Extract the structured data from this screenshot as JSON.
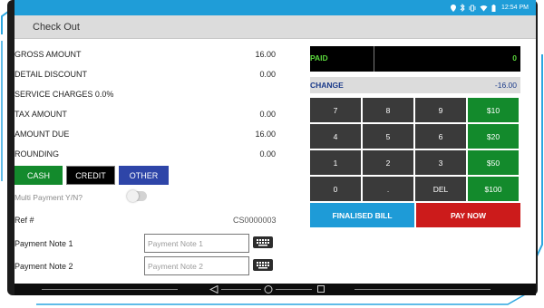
{
  "status_bar": {
    "icons": [
      "location-icon",
      "bluetooth-icon",
      "vibrate-icon",
      "wifi-icon",
      "battery-icon"
    ],
    "time": "12:54 PM",
    "color": "#1f9dd8"
  },
  "header": {
    "title": "Check Out"
  },
  "summary": {
    "gross_amount": {
      "label": "GROSS AMOUNT",
      "value": "16.00"
    },
    "detail_discount": {
      "label": "DETAIL DISCOUNT",
      "value": "0.00"
    },
    "service_charges": {
      "label": "SERVICE CHARGES 0.0%",
      "value": ""
    },
    "tax_amount": {
      "label": "TAX AMOUNT",
      "value": "0.00"
    },
    "amount_due": {
      "label": "AMOUNT DUE",
      "value": "16.00"
    },
    "rounding": {
      "label": "ROUNDING",
      "value": "0.00"
    }
  },
  "payment_types": [
    {
      "label": "CASH",
      "color": "#138a2c"
    },
    {
      "label": "CREDIT",
      "color": "#000000"
    },
    {
      "label": "OTHER",
      "color": "#2e45a8"
    }
  ],
  "multi_payment": {
    "label": "Multi Payment Y/N?",
    "enabled": false
  },
  "ref": {
    "label": "Ref #",
    "value": "CS0000003"
  },
  "notes": [
    {
      "label": "Payment Note 1",
      "placeholder": "Payment Note 1"
    },
    {
      "label": "Payment Note 2",
      "placeholder": "Payment Note 2"
    }
  ],
  "paid": {
    "label": "PAID",
    "value": "0"
  },
  "change": {
    "label": "CHANGE",
    "value": "-16.00"
  },
  "keypad": {
    "keys": [
      {
        "label": "7",
        "type": "digit"
      },
      {
        "label": "8",
        "type": "digit"
      },
      {
        "label": "9",
        "type": "digit"
      },
      {
        "label": "$10",
        "type": "money"
      },
      {
        "label": "4",
        "type": "digit"
      },
      {
        "label": "5",
        "type": "digit"
      },
      {
        "label": "6",
        "type": "digit"
      },
      {
        "label": "$20",
        "type": "money"
      },
      {
        "label": "1",
        "type": "digit"
      },
      {
        "label": "2",
        "type": "digit"
      },
      {
        "label": "3",
        "type": "digit"
      },
      {
        "label": "$50",
        "type": "money"
      },
      {
        "label": "0",
        "type": "digit"
      },
      {
        "label": ".",
        "type": "digit"
      },
      {
        "label": "DEL",
        "type": "digit"
      },
      {
        "label": "$100",
        "type": "money"
      }
    ]
  },
  "actions": {
    "finalised_bill": {
      "label": "FINALISED BILL",
      "color": "#1e9bd7"
    },
    "pay_now": {
      "label": "PAY NOW",
      "color": "#cc1b1b"
    }
  }
}
